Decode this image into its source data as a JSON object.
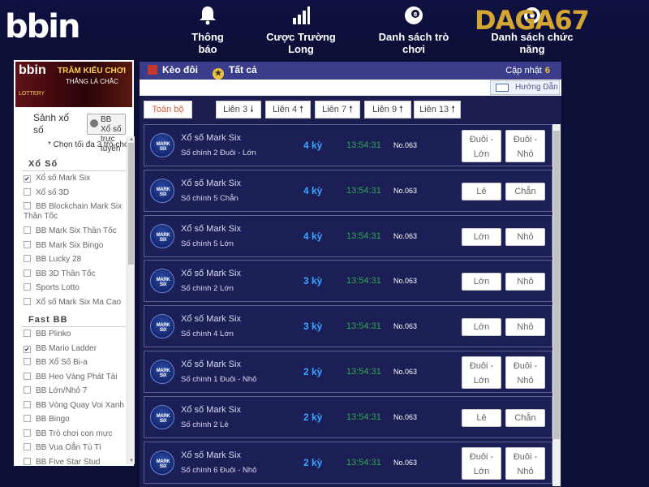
{
  "header": {
    "logo": "bbin",
    "brand": "DAGA67",
    "nav": [
      {
        "label": "Thông báo",
        "icon": "bell-icon"
      },
      {
        "label": "Cược Trường Long",
        "icon": "bar-chart-icon"
      },
      {
        "label": "Danh sách trò chơi",
        "icon": "lottery-ball-icon"
      },
      {
        "label": "Danh sách chức năng",
        "icon": "gear-icon"
      }
    ]
  },
  "sidebar": {
    "banner": {
      "logo": "bbin",
      "title": "TRĂM KIỂU CHƠI",
      "subtitle": "THẮNG LÀ CHẮC",
      "tag": "LOTTERY"
    },
    "hall_label": "Sảnh xổ số",
    "hall_button": "BB Xổ số trực tuyến",
    "choose_note": "* Chọn tối đa 3 trò chơi",
    "groups": [
      {
        "title": "Xổ Số",
        "items": [
          {
            "label": "Xổ số Mark Six",
            "checked": true
          },
          {
            "label": "Xổ số 3D",
            "checked": false
          },
          {
            "label": "BB Blockchain Mark Six Thần Tốc",
            "checked": false
          },
          {
            "label": "BB Mark Six Thần Tốc",
            "checked": false
          },
          {
            "label": "BB Mark Six Bingo",
            "checked": false
          },
          {
            "label": "BB Lucky 28",
            "checked": false
          },
          {
            "label": "BB 3D Thần Tốc",
            "checked": false
          },
          {
            "label": "Sports Lotto",
            "checked": false
          },
          {
            "label": "Xổ số Mark Six Ma Cao",
            "checked": false
          }
        ]
      },
      {
        "title": "Fast BB",
        "items": [
          {
            "label": "BB Plinko",
            "checked": false
          },
          {
            "label": "BB Mario Ladder",
            "checked": true
          },
          {
            "label": "BB Xổ Số Bi-a",
            "checked": false
          },
          {
            "label": "BB Heo Vàng Phát Tài",
            "checked": false
          },
          {
            "label": "BB Lớn/Nhỏ 7",
            "checked": false
          },
          {
            "label": "BB Vòng Quay Voi Xanh",
            "checked": false
          },
          {
            "label": "BB Bingo",
            "checked": false
          },
          {
            "label": "BB Trò chơi con mực",
            "checked": false
          },
          {
            "label": "BB Vua Oẳn Tù Tì",
            "checked": false
          },
          {
            "label": "BB Five Star Stud",
            "checked": false
          }
        ]
      }
    ]
  },
  "main": {
    "tabs": [
      {
        "label": "Kèo đôi",
        "icon": "bar-chart-icon"
      },
      {
        "label": "Tất cả",
        "icon": "star-icon"
      }
    ],
    "update_label": "Cập nhật",
    "update_count": "6",
    "guide_button": "Hướng Dẫn",
    "filters": [
      {
        "label": "Toàn bộ",
        "active": true
      },
      {
        "label": "Liên 3 🠗",
        "active": false
      },
      {
        "label": "Liên 4 🠕",
        "active": false
      },
      {
        "label": "Liên 7 🠕",
        "active": false
      },
      {
        "label": "Liên 9 🠕",
        "active": false
      },
      {
        "label": "Liên 13 🠕",
        "active": false
      }
    ],
    "icon_text": "MARK SIX",
    "rows": [
      {
        "game": "Xổ số Mark Six",
        "bet": "Số chính 2 Đuôi - Lớn",
        "ky": "4 kỳ",
        "time": "13:54:31",
        "no": "No.063",
        "options": [
          "Đuôi - Lớn",
          "Đuôi - Nhỏ"
        ]
      },
      {
        "game": "Xổ số Mark Six",
        "bet": "Số chính 5 Chẵn",
        "ky": "4 kỳ",
        "time": "13:54:31",
        "no": "No.063",
        "options": [
          "Lẻ",
          "Chẵn"
        ]
      },
      {
        "game": "Xổ số Mark Six",
        "bet": "Số chính 5 Lớn",
        "ky": "4 kỳ",
        "time": "13:54:31",
        "no": "No.063",
        "options": [
          "Lớn",
          "Nhỏ"
        ]
      },
      {
        "game": "Xổ số Mark Six",
        "bet": "Số chính 2 Lớn",
        "ky": "3 kỳ",
        "time": "13:54:31",
        "no": "No.063",
        "options": [
          "Lớn",
          "Nhỏ"
        ]
      },
      {
        "game": "Xổ số Mark Six",
        "bet": "Số chính 4 Lớn",
        "ky": "3 kỳ",
        "time": "13:54:31",
        "no": "No.063",
        "options": [
          "Lớn",
          "Nhỏ"
        ]
      },
      {
        "game": "Xổ số Mark Six",
        "bet": "Số chính 1 Đuôi - Nhỏ",
        "ky": "2 kỳ",
        "time": "13:54:31",
        "no": "No.063",
        "options": [
          "Đuôi - Lớn",
          "Đuôi - Nhỏ"
        ]
      },
      {
        "game": "Xổ số Mark Six",
        "bet": "Số chính 2 Lẻ",
        "ky": "2 kỳ",
        "time": "13:54:31",
        "no": "No.063",
        "options": [
          "Lẻ",
          "Chẵn"
        ]
      },
      {
        "game": "Xổ số Mark Six",
        "bet": "Số chính 6 Đuôi - Nhỏ",
        "ky": "2 kỳ",
        "time": "13:54:31",
        "no": "No.063",
        "options": [
          "Đuôi - Lớn",
          "Đuôi - Nhỏ"
        ]
      }
    ]
  },
  "colors": {
    "background": "#0c0f36",
    "panel": "#1c1f55",
    "header_bar": "#3b3d8a",
    "ky": "#3aa6ff",
    "time": "#2ea84c",
    "brand": "#d5a534",
    "active_filter": "#e05a3a"
  }
}
